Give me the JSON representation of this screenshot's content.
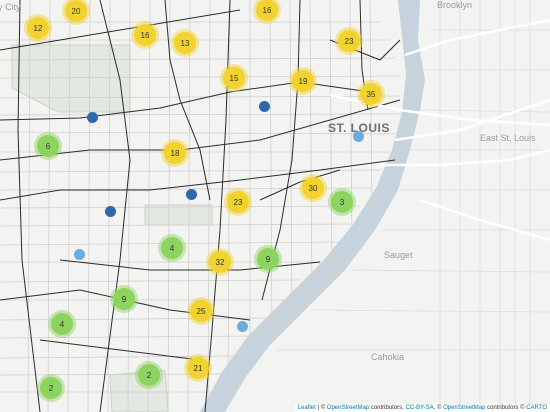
{
  "map": {
    "place_labels": {
      "city_partial": "y City",
      "brooklyn": "Brooklyn",
      "st_louis": "ST. LOUIS",
      "east_st_louis": "East St. Louis",
      "sauget": "Sauget",
      "cahokia": "Cahokia"
    },
    "colors": {
      "yellow_cluster": "#f1d22e",
      "green_cluster": "#8dd35f",
      "dark_point": "#2f68ad",
      "light_point": "#6eaadd",
      "river": "#c6d3dc",
      "land": "#f3f3f1",
      "roads": "#2b2b2b"
    },
    "clusters": [
      {
        "count": "20",
        "color": "yellow"
      },
      {
        "count": "16",
        "color": "yellow"
      },
      {
        "count": "12",
        "color": "yellow"
      },
      {
        "count": "16",
        "color": "yellow"
      },
      {
        "count": "13",
        "color": "yellow"
      },
      {
        "count": "23",
        "color": "yellow"
      },
      {
        "count": "15",
        "color": "yellow"
      },
      {
        "count": "19",
        "color": "yellow"
      },
      {
        "count": "35",
        "color": "yellow"
      },
      {
        "count": "6",
        "color": "green"
      },
      {
        "count": "18",
        "color": "yellow"
      },
      {
        "count": "30",
        "color": "yellow"
      },
      {
        "count": "23",
        "color": "yellow"
      },
      {
        "count": "3",
        "color": "green"
      },
      {
        "count": "4",
        "color": "green"
      },
      {
        "count": "32",
        "color": "yellow"
      },
      {
        "count": "9",
        "color": "green"
      },
      {
        "count": "9",
        "color": "green"
      },
      {
        "count": "4",
        "color": "green"
      },
      {
        "count": "25",
        "color": "yellow"
      },
      {
        "count": "21",
        "color": "yellow"
      },
      {
        "count": "2",
        "color": "green"
      },
      {
        "count": "2",
        "color": "green"
      }
    ],
    "points": [
      {
        "color": "dark"
      },
      {
        "color": "dark"
      },
      {
        "color": "dark"
      },
      {
        "color": "dark"
      },
      {
        "color": "light"
      },
      {
        "color": "light"
      },
      {
        "color": "light"
      }
    ]
  },
  "attribution": {
    "leaflet": "Leaflet",
    "sep": " | © ",
    "osm": "OpenStreetMap",
    "contributors1": " contributors, ",
    "license": "CC-BY-SA",
    "sep2": ", © ",
    "osm2": "OpenStreetMap",
    "contributors2": " contributors © ",
    "carto": "CARTO"
  }
}
